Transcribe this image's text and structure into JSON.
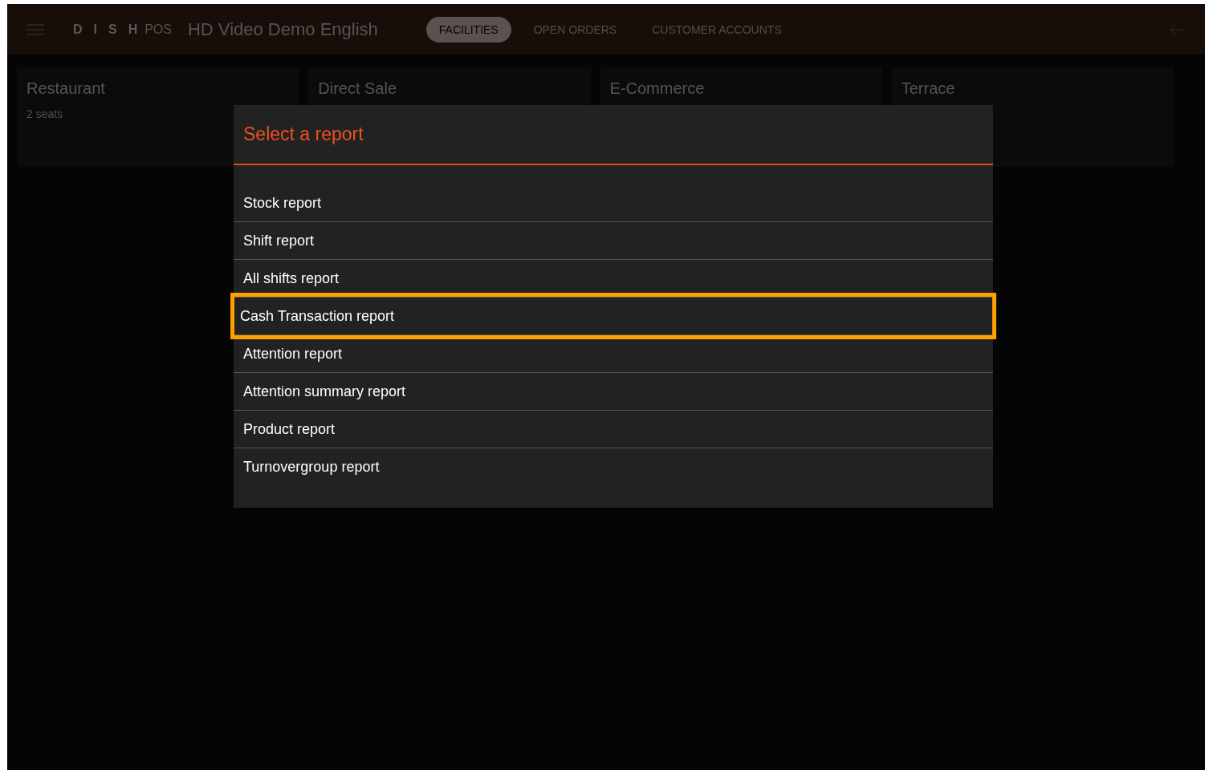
{
  "header": {
    "logo": "D I S H",
    "logo_suffix": "POS",
    "title": "HD Video Demo English",
    "tabs": [
      {
        "label": "FACILITIES",
        "selected": true
      },
      {
        "label": "OPEN ORDERS",
        "selected": false
      },
      {
        "label": "CUSTOMER ACCOUNTS",
        "selected": false
      }
    ]
  },
  "facilities": [
    {
      "name": "Restaurant",
      "detail": "2 seats"
    },
    {
      "name": "Direct Sale"
    },
    {
      "name": "E-Commerce"
    },
    {
      "name": "Terrace"
    }
  ],
  "dialog": {
    "title": "Select a report",
    "items": [
      {
        "label": "Stock report",
        "highlighted": false
      },
      {
        "label": "Shift report",
        "highlighted": false
      },
      {
        "label": "All shifts report",
        "highlighted": false
      },
      {
        "label": "Cash Transaction report",
        "highlighted": true
      },
      {
        "label": "Attention report",
        "highlighted": false
      },
      {
        "label": "Attention summary report",
        "highlighted": false
      },
      {
        "label": "Product report",
        "highlighted": false
      },
      {
        "label": "Turnovergroup report",
        "highlighted": false
      }
    ]
  }
}
